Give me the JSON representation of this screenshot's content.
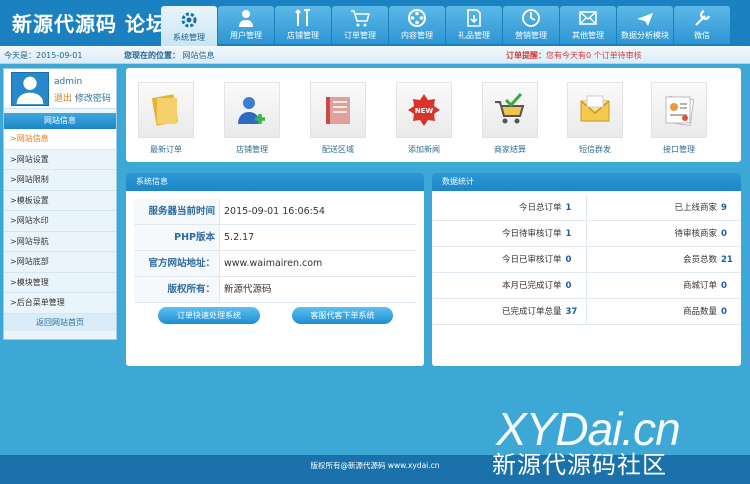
{
  "app": {
    "logo": "新源代源码 论坛"
  },
  "nav": [
    {
      "label": "系统管理",
      "icon": "gear-icon",
      "active": true
    },
    {
      "label": "用户管理",
      "icon": "user-icon"
    },
    {
      "label": "店铺管理",
      "icon": "tools-icon"
    },
    {
      "label": "订单管理",
      "icon": "cart-icon"
    },
    {
      "label": "内容管理",
      "icon": "film-icon"
    },
    {
      "label": "礼品管理",
      "icon": "download-icon"
    },
    {
      "label": "营销管理",
      "icon": "clock-icon"
    },
    {
      "label": "其他管理",
      "icon": "mail-icon"
    },
    {
      "label": "数据分析模块",
      "icon": "plane-icon"
    },
    {
      "label": "微信",
      "icon": "wrench-icon"
    }
  ],
  "infobar": {
    "date": "今天是：2015-09-01",
    "location_label": "您现在的位置：",
    "location": "网站信息",
    "alert_label": "订单提醒：",
    "alert_text": "您有今天有0 个订单待审核"
  },
  "sidebar": {
    "username": "admin",
    "logout": "退出",
    "change_password": "修改密码",
    "title": "网站信息",
    "items": [
      ">网站信息",
      ">网站设置",
      ">网站限制",
      ">模板设置",
      ">网站水印",
      ">网站导航",
      ">网站底部",
      ">模块管理",
      ">后台菜单管理"
    ],
    "footer": "返回网站首页"
  },
  "shortcuts": [
    {
      "label": "最新订单",
      "icon": "folder-icon"
    },
    {
      "label": "店铺管理",
      "icon": "add-user-icon"
    },
    {
      "label": "配送区域",
      "icon": "book-icon"
    },
    {
      "label": "添加新闻",
      "icon": "new-badge-icon"
    },
    {
      "label": "商家结算",
      "icon": "cart-check-icon"
    },
    {
      "label": "短信群发",
      "icon": "envelope-icon"
    },
    {
      "label": "接口管理",
      "icon": "id-card-icon"
    }
  ],
  "sysinfo": {
    "title": "系统信息",
    "rows": [
      {
        "k": "服务器当前时间",
        "v": "2015-09-01 16:06:54"
      },
      {
        "k": "PHP版本",
        "v": "5.2.17"
      },
      {
        "k": "官方网站地址：",
        "v": "www.waimairen.com"
      },
      {
        "k": "版权所有：",
        "v": "新源代源码"
      }
    ],
    "btn1": "订单快速处理系统",
    "btn2": "客服代客下单系统"
  },
  "stats": {
    "title": "数据统计",
    "rows": [
      [
        {
          "k": "今日总订单",
          "v": "1"
        },
        {
          "k": "已上线商家",
          "v": "9"
        }
      ],
      [
        {
          "k": "今日待审核订单",
          "v": "1"
        },
        {
          "k": "待审核商家",
          "v": "0"
        }
      ],
      [
        {
          "k": "今日已审核订单",
          "v": "0"
        },
        {
          "k": "会员总数",
          "v": "21"
        }
      ],
      [
        {
          "k": "本月已完成订单",
          "v": "0"
        },
        {
          "k": "商城订单",
          "v": "0"
        }
      ],
      [
        {
          "k": "已完成订单总量",
          "v": "37"
        },
        {
          "k": "商品数量",
          "v": "0"
        }
      ]
    ]
  },
  "footer": "版权所有@新源代源码 www.xydai.cn",
  "watermark": {
    "en": "XYDai.cn",
    "cn": "新源代源码社区"
  }
}
